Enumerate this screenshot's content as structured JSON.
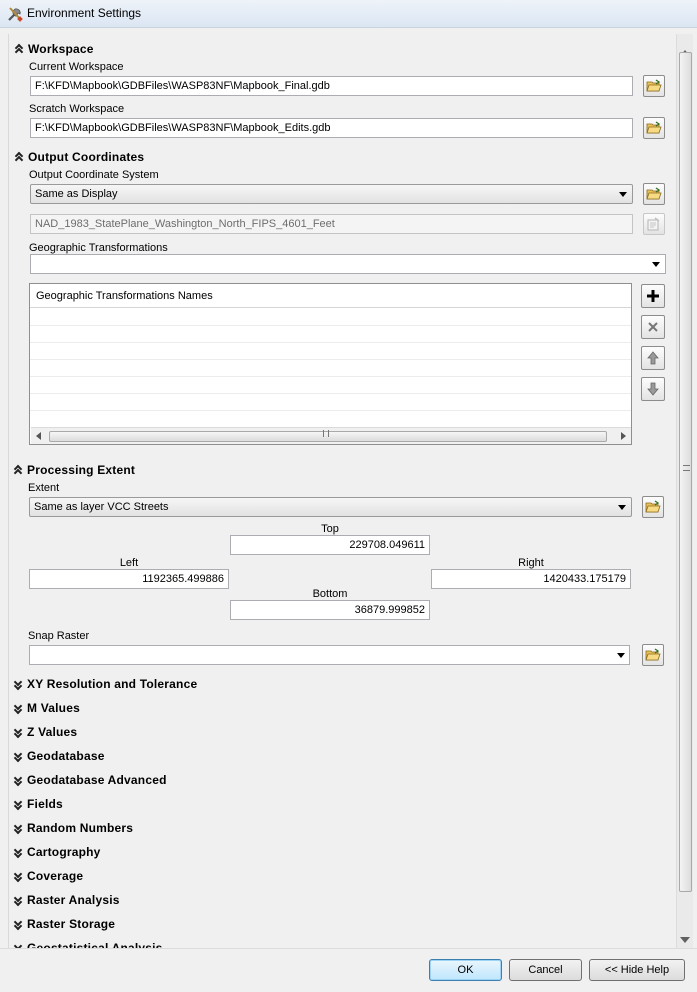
{
  "window": {
    "title": "Environment Settings"
  },
  "workspace": {
    "header": "Workspace",
    "current_label": "Current Workspace",
    "current_value": "F:\\KFD\\Mapbook\\GDBFiles\\WASP83NF\\Mapbook_Final.gdb",
    "scratch_label": "Scratch Workspace",
    "scratch_value": "F:\\KFD\\Mapbook\\GDBFiles\\WASP83NF\\Mapbook_Edits.gdb"
  },
  "output_coordinates": {
    "header": "Output Coordinates",
    "system_label": "Output Coordinate System",
    "system_value": "Same as Display",
    "projection_value": "NAD_1983_StatePlane_Washington_North_FIPS_4601_Feet",
    "geo_trans_label": "Geographic Transformations",
    "geo_trans_value": "",
    "table_header": "Geographic Transformations Names"
  },
  "processing_extent": {
    "header": "Processing Extent",
    "extent_label": "Extent",
    "extent_value": "Same as layer VCC Streets",
    "top_label": "Top",
    "top_value": "229708.049611",
    "left_label": "Left",
    "left_value": "1192365.499886",
    "right_label": "Right",
    "right_value": "1420433.175179",
    "bottom_label": "Bottom",
    "bottom_value": "36879.999852",
    "snap_label": "Snap Raster",
    "snap_value": ""
  },
  "collapsed_sections": [
    "XY Resolution and Tolerance",
    "M Values",
    "Z Values",
    "Geodatabase",
    "Geodatabase Advanced",
    "Fields",
    "Random Numbers",
    "Cartography",
    "Coverage",
    "Raster Analysis",
    "Raster Storage",
    "Geostatistical Analysis"
  ],
  "buttons": {
    "ok": "OK",
    "cancel": "Cancel",
    "hide_help": "<< Hide Help"
  },
  "icons": {
    "folder": "folder-open-icon",
    "add": "plus-icon",
    "remove": "x-icon",
    "up": "arrow-up-icon",
    "down": "arrow-down-icon"
  }
}
